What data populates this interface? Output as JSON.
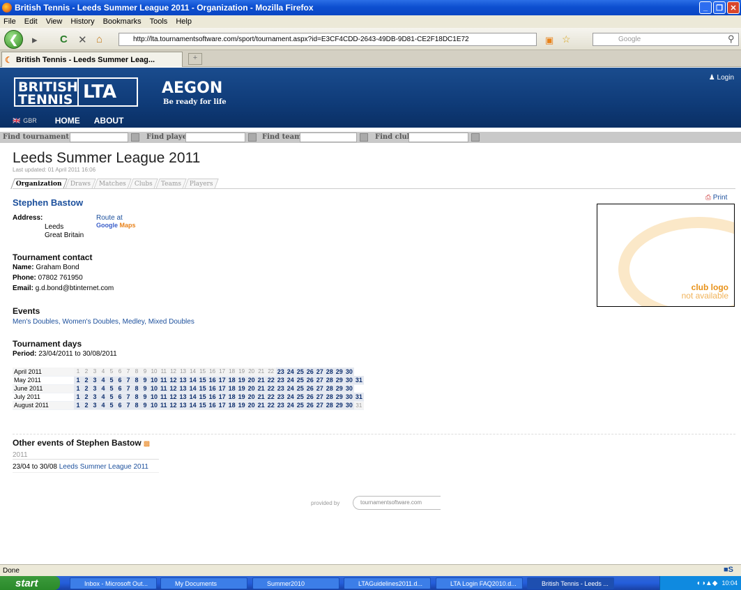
{
  "window": {
    "title": "British Tennis - Leeds Summer League 2011 - Organization - Mozilla Firefox"
  },
  "menu": [
    "File",
    "Edit",
    "View",
    "History",
    "Bookmarks",
    "Tools",
    "Help"
  ],
  "browser": {
    "url": "http://lta.tournamentsoftware.com/sport/tournament.aspx?id=E3CF4CDD-2643-49DB-9D81-CE2F18DC1E72",
    "search_placeholder": "Google",
    "tab_title": "British Tennis - Leeds Summer Leag..."
  },
  "header": {
    "logo_line1": "BRITISH",
    "logo_line2": "TENNIS",
    "logo_lta": "LTA",
    "logo_aegon": "AEGON",
    "tagline": "Be ready for life",
    "login": "Login",
    "country": "GBR",
    "nav": [
      "HOME",
      "ABOUT"
    ]
  },
  "search": {
    "tournament": "Find tournament:",
    "player": "Find player:",
    "team": "Find team:",
    "club": "Find club:"
  },
  "page": {
    "title": "Leeds Summer League 2011",
    "last_updated": "Last updated: 01 April 2011 16:06",
    "tabs": [
      "Organization",
      "Draws",
      "Matches",
      "Clubs",
      "Teams",
      "Players"
    ],
    "active_tab": "Organization"
  },
  "org": {
    "name": "Stephen Bastow",
    "print": "Print",
    "address_label": "Address:",
    "address_lines": [
      "Leeds",
      "Great Britain"
    ],
    "route_text": "Route at",
    "google": "Google",
    "maps": "Maps"
  },
  "contact": {
    "heading": "Tournament contact",
    "name_label": "Name:",
    "name": "Graham Bond",
    "phone_label": "Phone:",
    "phone": "07802 761950",
    "email_label": "Email:",
    "email": "g.d.bond@btinternet.com"
  },
  "events": {
    "heading": "Events",
    "items": [
      "Men's Doubles",
      "Women's Doubles",
      "Medley",
      "Mixed Doubles"
    ]
  },
  "days": {
    "heading": "Tournament days",
    "period_label": "Period:",
    "period": "23/04/2011 to 30/08/2011"
  },
  "calendar": [
    {
      "month": "April 2011",
      "days": 30,
      "active_from": 23,
      "active_to": 30
    },
    {
      "month": "May 2011",
      "days": 31,
      "active_from": 1,
      "active_to": 31
    },
    {
      "month": "June 2011",
      "days": 30,
      "active_from": 1,
      "active_to": 30
    },
    {
      "month": "July 2011",
      "days": 31,
      "active_from": 1,
      "active_to": 31
    },
    {
      "month": "August 2011",
      "days": 31,
      "active_from": 1,
      "active_to": 30
    }
  ],
  "other": {
    "heading": "Other events of Stephen Bastow",
    "year": "2011",
    "date_range": "23/04 to 30/08",
    "event": "Leeds Summer League 2011"
  },
  "club_logo": {
    "line1": "club logo",
    "line2": "not available"
  },
  "footer": {
    "provided_by": "provided by",
    "brand": "tournamentsoftware.com"
  },
  "status": "Done",
  "taskbar": {
    "start": "start",
    "items": [
      "Inbox - Microsoft Out...",
      "My Documents",
      "Summer2010",
      "LTAGuidelines2011.d...",
      "LTA Login FAQ2010.d...",
      "British Tennis - Leeds ..."
    ],
    "clock": "10:04"
  }
}
